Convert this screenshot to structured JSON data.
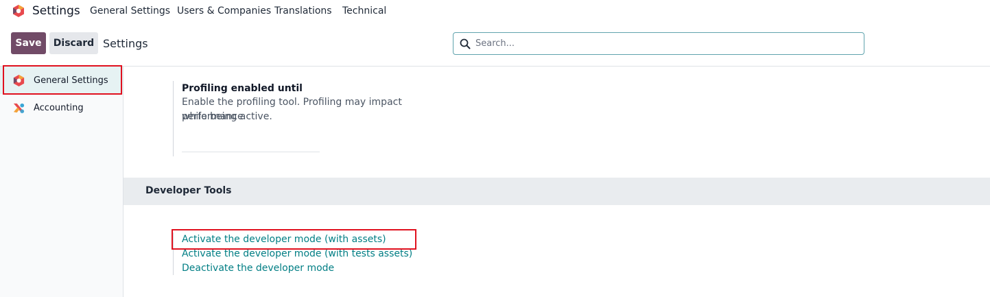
{
  "navbar": {
    "brand": "Settings",
    "menu": [
      "General Settings",
      "Users & Companies",
      "Translations",
      "Technical"
    ]
  },
  "control_panel": {
    "save_label": "Save",
    "discard_label": "Discard",
    "title": "Settings",
    "search_placeholder": "Search..."
  },
  "sidebar": {
    "items": [
      {
        "label": "General Settings",
        "icon": "odoo-logo-icon",
        "active": true
      },
      {
        "label": "Accounting",
        "icon": "accounting-app-icon",
        "active": false
      }
    ]
  },
  "profiling": {
    "title": "Profiling enabled until",
    "description_line1": "Enable the profiling tool. Profiling may impact performance",
    "description_line2": "while being active."
  },
  "developer_tools": {
    "section_title": "Developer Tools",
    "links": [
      "Activate the developer mode (with assets)",
      "Activate the developer mode (with tests assets)",
      "Deactivate the developer mode"
    ]
  },
  "colors": {
    "primary": "#714b67",
    "link": "#017e84",
    "highlight": "#e0101e",
    "active_bg": "#e6f2f3"
  }
}
